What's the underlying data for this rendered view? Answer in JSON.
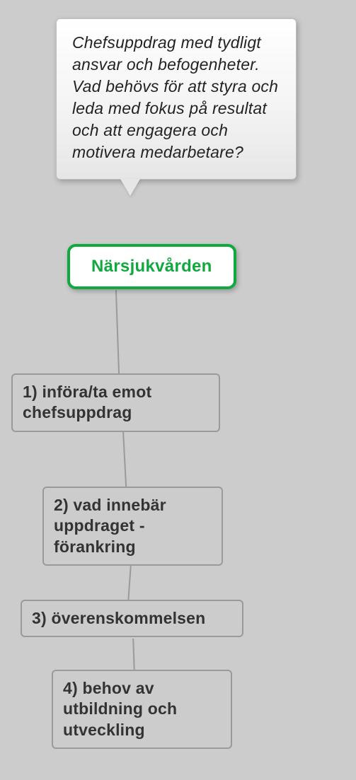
{
  "callout": {
    "text": "Chefsuppdrag med tydligt ansvar och befogenheter. Vad behövs för att styra och leda med fokus på resultat och att engagera och motivera medarbetare?"
  },
  "root": {
    "label": "Närsjukvården"
  },
  "steps": [
    {
      "label": "1) införa/ta emot chefsuppdrag"
    },
    {
      "label": "2) vad innebär uppdraget - förankring"
    },
    {
      "label": "3) överenskommelsen"
    },
    {
      "label": "4) behov av utbildning och utveckling"
    }
  ]
}
